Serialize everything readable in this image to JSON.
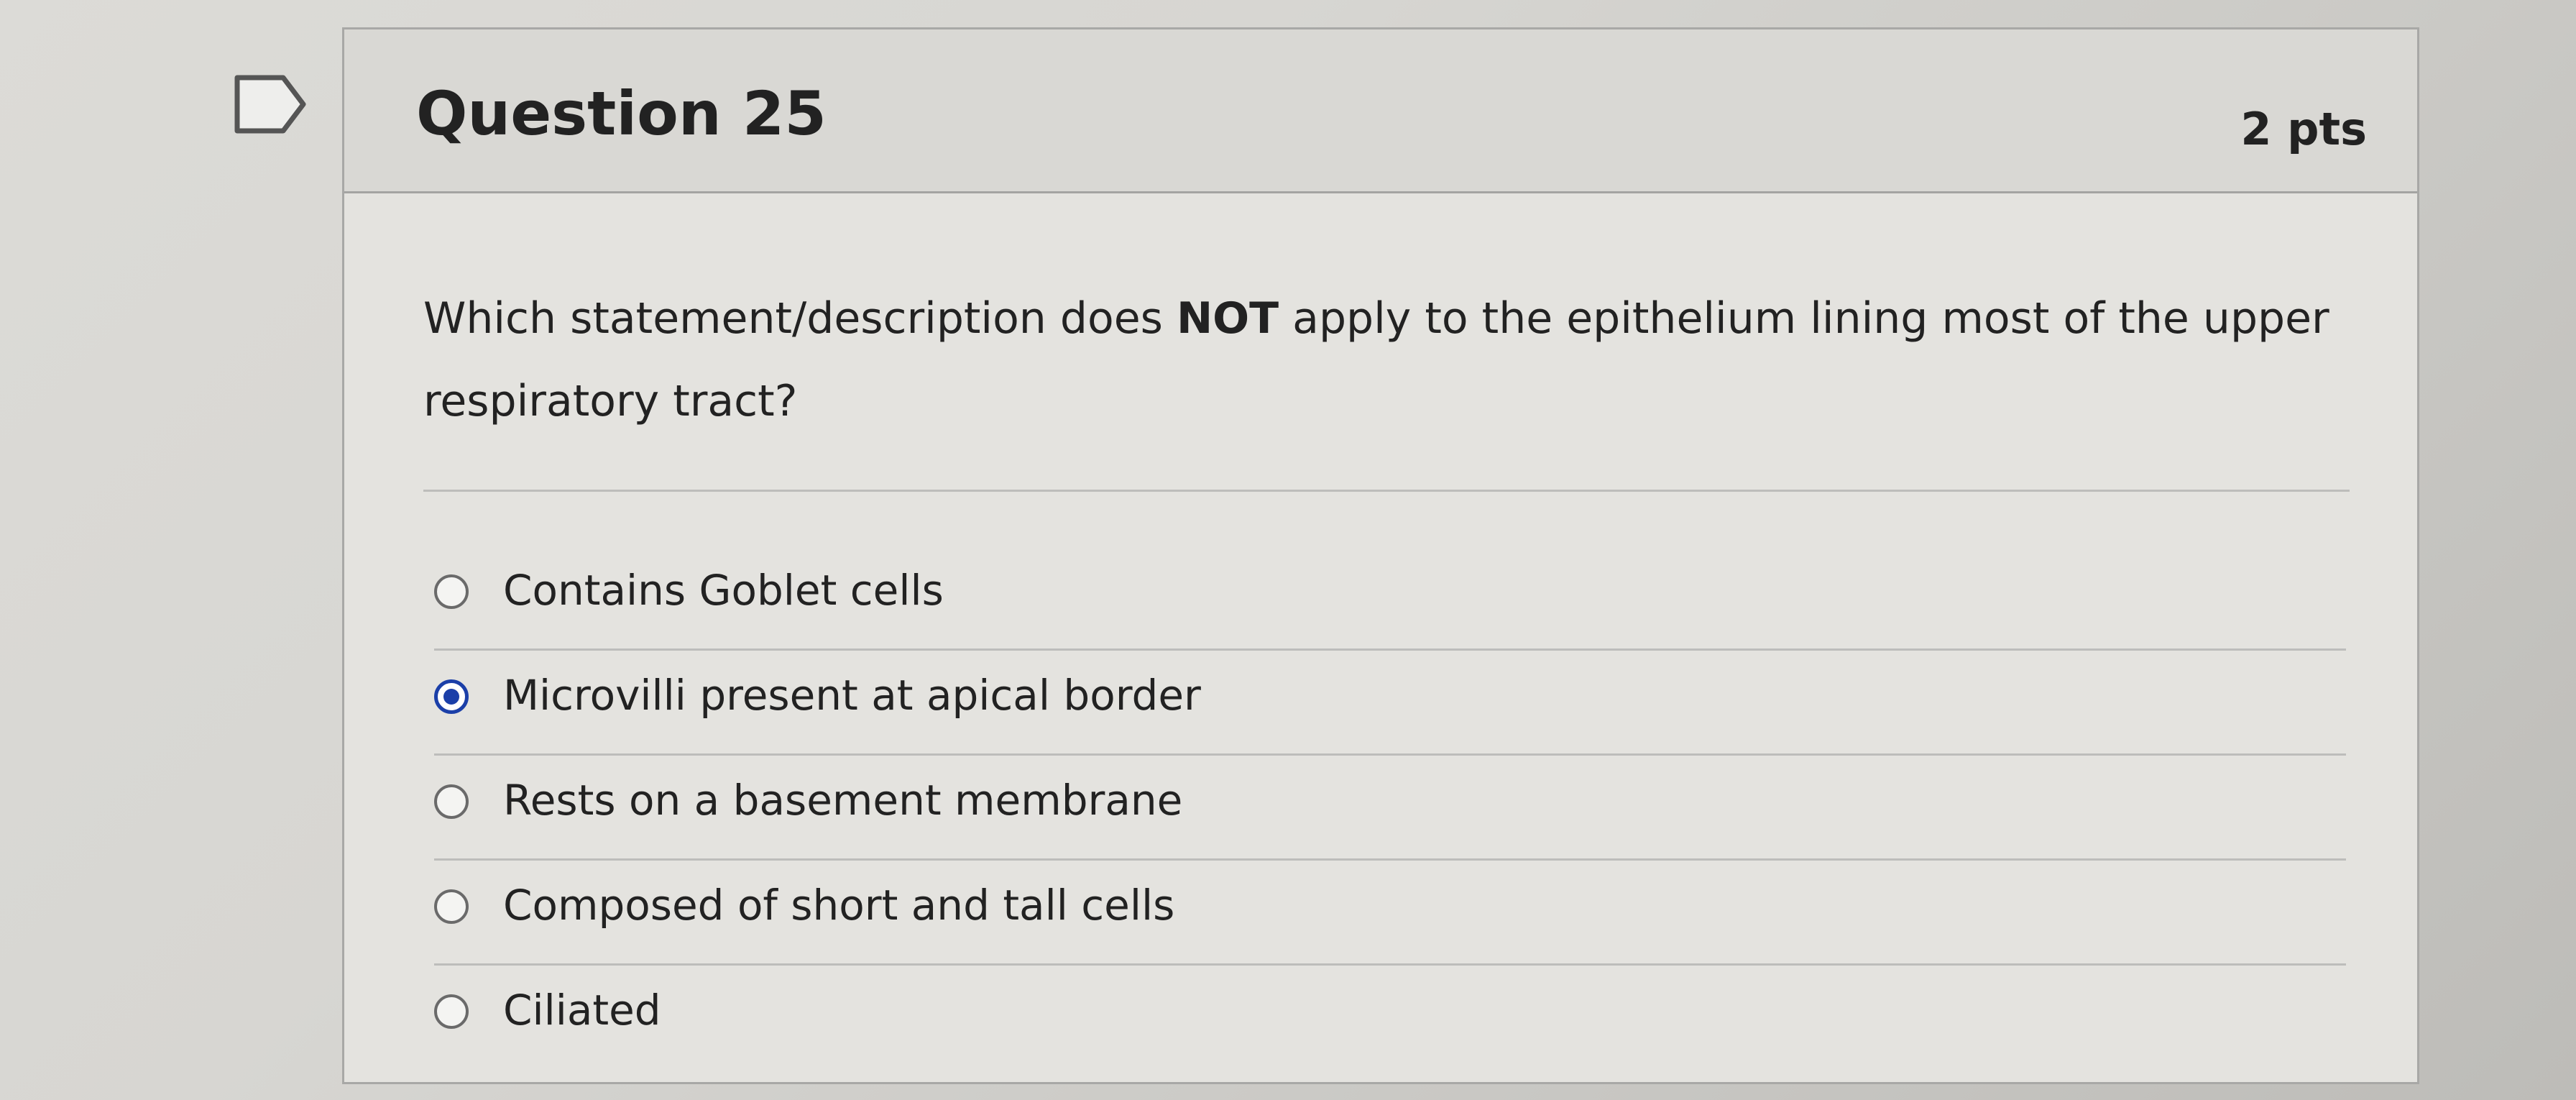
{
  "question": {
    "title": "Question 25",
    "points": "2 pts",
    "text_before_bold": "Which statement/description does ",
    "text_bold": "NOT",
    "text_after_bold": " apply to the epithelium lining most of the upper respiratory tract?"
  },
  "answers": [
    {
      "label": "Contains Goblet cells",
      "selected": false
    },
    {
      "label": "Microvilli present at apical border",
      "selected": true
    },
    {
      "label": "Rests on a basement membrane",
      "selected": false
    },
    {
      "label": "Composed of short and tall cells",
      "selected": false
    },
    {
      "label": "Ciliated",
      "selected": false
    }
  ],
  "icons": {
    "flag": "flag-icon"
  },
  "colors": {
    "radio_selected": "#1b3fa8"
  }
}
